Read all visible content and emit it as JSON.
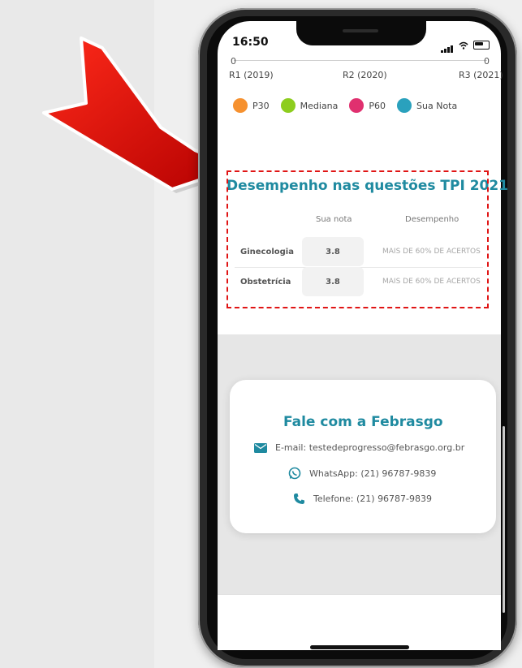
{
  "status_bar": {
    "time": "16:50"
  },
  "chart": {
    "axis_zero": "0",
    "x_ticks": [
      "R1 (2019)",
      "R2 (2020)",
      "R3 (2021)"
    ],
    "legend": [
      {
        "label": "P30",
        "color": "#f6912f"
      },
      {
        "label": "Mediana",
        "color": "#8dcd1e"
      },
      {
        "label": "P60",
        "color": "#e0306f"
      },
      {
        "label": "Sua Nota",
        "color": "#2aa1bd"
      }
    ]
  },
  "tpi": {
    "title": "Desempenho nas questões TPI 2021",
    "headers": [
      "Sua nota",
      "Desempenho"
    ],
    "rows": [
      {
        "area": "Ginecologia",
        "score": "3.8",
        "performance": "MAIS DE 60% DE ACERTOS"
      },
      {
        "area": "Obstetrícia",
        "score": "3.8",
        "performance": "MAIS DE 60% DE ACERTOS"
      }
    ]
  },
  "contact": {
    "title": "Fale com a Febrasgo",
    "email": "E-mail: testedeprogresso@febrasgo.org.br",
    "whatsapp": "WhatsApp: (21) 96787-9839",
    "telefone": "Telefone: (21) 96787-9839"
  },
  "colors": {
    "accent": "#1f8aa0",
    "highlight_border": "#e01515",
    "arrow": "#d21212"
  }
}
